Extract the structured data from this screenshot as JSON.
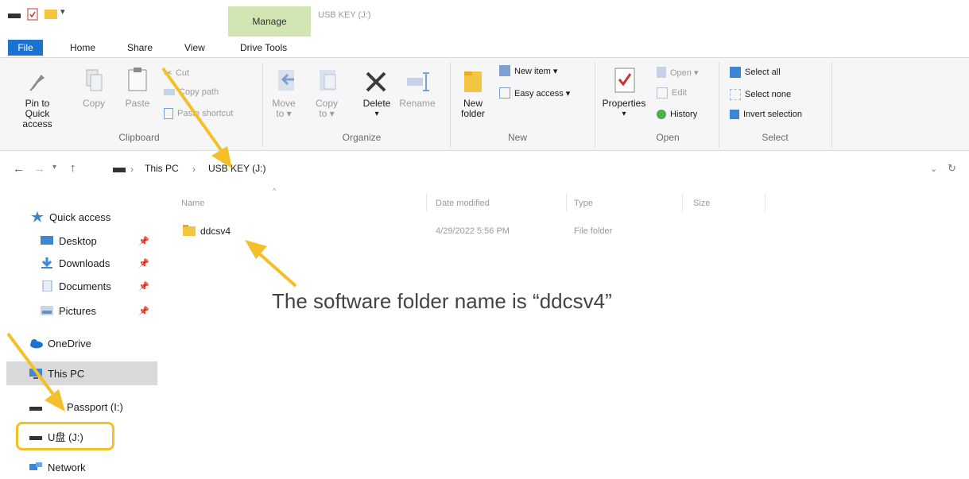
{
  "title_bar": {
    "manage_tab": "Manage",
    "window_title": "USB KEY (J:)"
  },
  "ribbon_tabs": [
    "File",
    "Home",
    "Share",
    "View",
    "Drive Tools"
  ],
  "ribbon": {
    "clipboard": {
      "pin": [
        "Pin to Quick",
        "access"
      ],
      "copy": "Copy",
      "paste": "Paste",
      "cut": "Cut",
      "copy_path": "Copy path",
      "paste_shortcut": "Paste shortcut",
      "label": "Clipboard"
    },
    "organize": {
      "move_to": [
        "Move",
        "to ▾"
      ],
      "copy_to": [
        "Copy",
        "to ▾"
      ],
      "delete": "Delete",
      "delete_arrow": "▾",
      "rename": "Rename",
      "label": "Organize"
    },
    "new": {
      "new_folder": [
        "New",
        "folder"
      ],
      "new_item": "New item ▾",
      "easy_access": "Easy access ▾",
      "label": "New"
    },
    "open": {
      "properties": "Properties",
      "properties_arrow": "▾",
      "open": "Open ▾",
      "edit": "Edit",
      "history": "History",
      "label": "Open"
    },
    "select": {
      "select_all": "Select all",
      "select_none": "Select none",
      "invert": "Invert selection",
      "label": "Select"
    }
  },
  "address": {
    "path": [
      "This PC",
      "USB KEY (J:)"
    ],
    "separator": "›"
  },
  "columns": [
    "Name",
    "Date modified",
    "Type",
    "Size"
  ],
  "files": [
    {
      "name": "ddcsv4",
      "date": "4/29/2022 5:56 PM",
      "type": "File folder",
      "size": ""
    }
  ],
  "nav": {
    "quick_access": "Quick access",
    "pinned": [
      "Desktop",
      "Downloads",
      "Documents",
      "Pictures"
    ],
    "onedrive": "OneDrive",
    "this_pc": "This PC",
    "passport": "Passport (I:)",
    "usb": "U盘 (J:)",
    "network": "Network"
  },
  "annotation": {
    "text": "The software folder name is “ddcsv4”",
    "color": "#f5bf29"
  }
}
